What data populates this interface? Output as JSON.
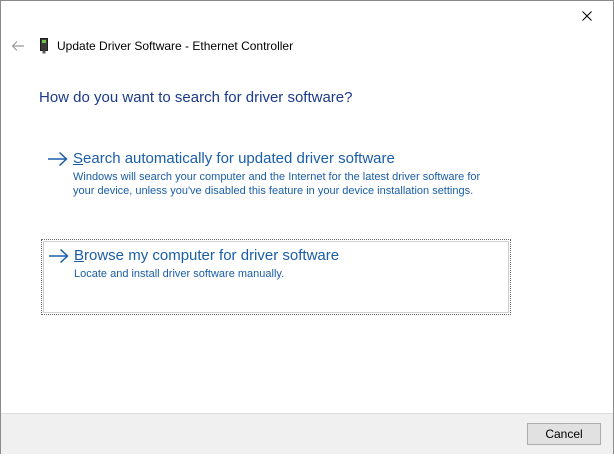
{
  "window": {
    "title": "Update Driver Software - Ethernet Controller"
  },
  "main": {
    "heading": "How do you want to search for driver software?",
    "options": [
      {
        "title_accel": "S",
        "title_rest": "earch automatically for updated driver software",
        "description": "Windows will search your computer and the Internet for the latest driver software for your device, unless you've disabled this feature in your device installation settings."
      },
      {
        "title_accel": "B",
        "title_rest": "rowse my computer for driver software",
        "description": "Locate and install driver software manually."
      }
    ]
  },
  "footer": {
    "cancel_label": "Cancel"
  },
  "icons": {
    "back": "back-arrow-icon",
    "device": "ethernet-controller-icon",
    "close": "close-icon",
    "option_arrow": "right-arrow-icon"
  },
  "colors": {
    "heading": "#1b3a8a",
    "link": "#1a5ea8",
    "footer_bg": "#f0f0f0"
  }
}
